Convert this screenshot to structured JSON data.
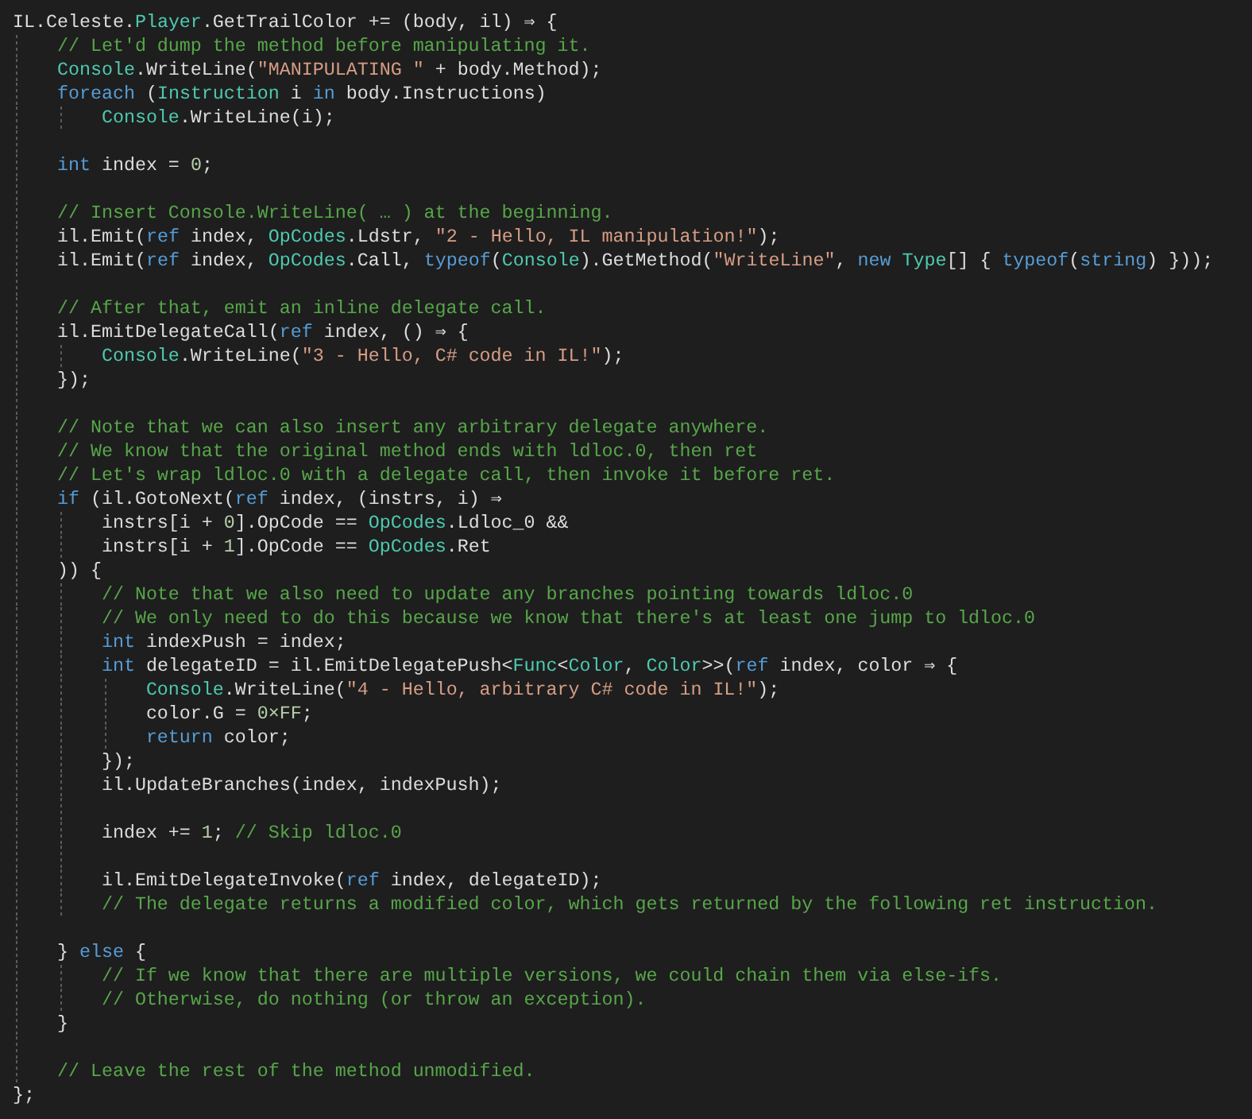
{
  "editor": {
    "lines": [
      {
        "kind": "code",
        "tokens": [
          {
            "kind": "plain",
            "text": "IL.Celeste."
          },
          {
            "kind": "type",
            "text": "Player"
          },
          {
            "kind": "plain",
            "text": ".GetTrailColor += (body, il) ⇒ {"
          }
        ]
      },
      {
        "kind": "code",
        "tokens": [
          {
            "kind": "comment",
            "text": "    // Let'd dump the method before manipulating it."
          }
        ]
      },
      {
        "kind": "code",
        "tokens": [
          {
            "kind": "type",
            "text": "    Console"
          },
          {
            "kind": "plain",
            "text": ".WriteLine("
          },
          {
            "kind": "string",
            "text": "\"MANIPULATING \""
          },
          {
            "kind": "plain",
            "text": " + body.Method);"
          }
        ]
      },
      {
        "kind": "code",
        "tokens": [
          {
            "kind": "keyword",
            "text": "    foreach"
          },
          {
            "kind": "plain",
            "text": " ("
          },
          {
            "kind": "type",
            "text": "Instruction"
          },
          {
            "kind": "plain",
            "text": " i "
          },
          {
            "kind": "keyword",
            "text": "in"
          },
          {
            "kind": "plain",
            "text": " body.Instructions)"
          }
        ]
      },
      {
        "kind": "code",
        "tokens": [
          {
            "kind": "type",
            "text": "        Console"
          },
          {
            "kind": "plain",
            "text": ".WriteLine(i);"
          }
        ]
      },
      {
        "kind": "blank"
      },
      {
        "kind": "code",
        "tokens": [
          {
            "kind": "keyword",
            "text": "    int"
          },
          {
            "kind": "plain",
            "text": " index = "
          },
          {
            "kind": "number",
            "text": "0"
          },
          {
            "kind": "plain",
            "text": ";"
          }
        ]
      },
      {
        "kind": "blank"
      },
      {
        "kind": "code",
        "tokens": [
          {
            "kind": "comment",
            "text": "    // Insert Console.WriteLine( … ) at the beginning."
          }
        ]
      },
      {
        "kind": "code",
        "tokens": [
          {
            "kind": "plain",
            "text": "    il.Emit("
          },
          {
            "kind": "keyword",
            "text": "ref"
          },
          {
            "kind": "plain",
            "text": " index, "
          },
          {
            "kind": "type",
            "text": "OpCodes"
          },
          {
            "kind": "plain",
            "text": ".Ldstr, "
          },
          {
            "kind": "string",
            "text": "\"2 - Hello, IL manipulation!\""
          },
          {
            "kind": "plain",
            "text": ");"
          }
        ]
      },
      {
        "kind": "code",
        "tokens": [
          {
            "kind": "plain",
            "text": "    il.Emit("
          },
          {
            "kind": "keyword",
            "text": "ref"
          },
          {
            "kind": "plain",
            "text": " index, "
          },
          {
            "kind": "type",
            "text": "OpCodes"
          },
          {
            "kind": "plain",
            "text": ".Call, "
          },
          {
            "kind": "keyword",
            "text": "typeof"
          },
          {
            "kind": "plain",
            "text": "("
          },
          {
            "kind": "type",
            "text": "Console"
          },
          {
            "kind": "plain",
            "text": ").GetMethod("
          },
          {
            "kind": "string",
            "text": "\"WriteLine\""
          },
          {
            "kind": "plain",
            "text": ", "
          },
          {
            "kind": "keyword",
            "text": "new"
          },
          {
            "kind": "type",
            "text": " Type"
          },
          {
            "kind": "plain",
            "text": "[] { "
          },
          {
            "kind": "keyword",
            "text": "typeof"
          },
          {
            "kind": "plain",
            "text": "("
          },
          {
            "kind": "keyword",
            "text": "string"
          },
          {
            "kind": "plain",
            "text": ") }));"
          }
        ]
      },
      {
        "kind": "blank"
      },
      {
        "kind": "code",
        "tokens": [
          {
            "kind": "comment",
            "text": "    // After that, emit an inline delegate call."
          }
        ]
      },
      {
        "kind": "code",
        "tokens": [
          {
            "kind": "plain",
            "text": "    il.EmitDelegateCall("
          },
          {
            "kind": "keyword",
            "text": "ref"
          },
          {
            "kind": "plain",
            "text": " index, () ⇒ {"
          }
        ]
      },
      {
        "kind": "code",
        "tokens": [
          {
            "kind": "type",
            "text": "        Console"
          },
          {
            "kind": "plain",
            "text": ".WriteLine("
          },
          {
            "kind": "string",
            "text": "\"3 - Hello, C# code in IL!\""
          },
          {
            "kind": "plain",
            "text": ");"
          }
        ]
      },
      {
        "kind": "code",
        "tokens": [
          {
            "kind": "plain",
            "text": "    });"
          }
        ]
      },
      {
        "kind": "blank"
      },
      {
        "kind": "code",
        "tokens": [
          {
            "kind": "comment",
            "text": "    // Note that we can also insert any arbitrary delegate anywhere."
          }
        ]
      },
      {
        "kind": "code",
        "tokens": [
          {
            "kind": "comment",
            "text": "    // We know that the original method ends with ldloc.0, then ret"
          }
        ]
      },
      {
        "kind": "code",
        "tokens": [
          {
            "kind": "comment",
            "text": "    // Let's wrap ldloc.0 with a delegate call, then invoke it before ret."
          }
        ]
      },
      {
        "kind": "code",
        "tokens": [
          {
            "kind": "keyword",
            "text": "    if"
          },
          {
            "kind": "plain",
            "text": " (il.GotoNext("
          },
          {
            "kind": "keyword",
            "text": "ref"
          },
          {
            "kind": "plain",
            "text": " index, (instrs, i) ⇒"
          }
        ]
      },
      {
        "kind": "code",
        "tokens": [
          {
            "kind": "plain",
            "text": "        instrs[i + "
          },
          {
            "kind": "number",
            "text": "0"
          },
          {
            "kind": "plain",
            "text": "].OpCode == "
          },
          {
            "kind": "type",
            "text": "OpCodes"
          },
          {
            "kind": "plain",
            "text": ".Ldloc_0 &&"
          }
        ]
      },
      {
        "kind": "code",
        "tokens": [
          {
            "kind": "plain",
            "text": "        instrs[i + "
          },
          {
            "kind": "number",
            "text": "1"
          },
          {
            "kind": "plain",
            "text": "].OpCode == "
          },
          {
            "kind": "type",
            "text": "OpCodes"
          },
          {
            "kind": "plain",
            "text": ".Ret"
          }
        ]
      },
      {
        "kind": "code",
        "tokens": [
          {
            "kind": "plain",
            "text": "    )) {"
          }
        ]
      },
      {
        "kind": "code",
        "tokens": [
          {
            "kind": "comment",
            "text": "        // Note that we also need to update any branches pointing towards ldloc.0"
          }
        ]
      },
      {
        "kind": "code",
        "tokens": [
          {
            "kind": "comment",
            "text": "        // We only need to do this because we know that there's at least one jump to ldloc.0"
          }
        ]
      },
      {
        "kind": "code",
        "tokens": [
          {
            "kind": "keyword",
            "text": "        int"
          },
          {
            "kind": "plain",
            "text": " indexPush = index;"
          }
        ]
      },
      {
        "kind": "code",
        "tokens": [
          {
            "kind": "keyword",
            "text": "        int"
          },
          {
            "kind": "plain",
            "text": " delegateID = il.EmitDelegatePush<"
          },
          {
            "kind": "type",
            "text": "Func"
          },
          {
            "kind": "plain",
            "text": "<"
          },
          {
            "kind": "type",
            "text": "Color"
          },
          {
            "kind": "plain",
            "text": ", "
          },
          {
            "kind": "type",
            "text": "Color"
          },
          {
            "kind": "plain",
            "text": ">>("
          },
          {
            "kind": "keyword",
            "text": "ref"
          },
          {
            "kind": "plain",
            "text": " index, color ⇒ {"
          }
        ]
      },
      {
        "kind": "code",
        "tokens": [
          {
            "kind": "type",
            "text": "            Console"
          },
          {
            "kind": "plain",
            "text": ".WriteLine("
          },
          {
            "kind": "string",
            "text": "\"4 - Hello, arbitrary C# code in IL!\""
          },
          {
            "kind": "plain",
            "text": ");"
          }
        ]
      },
      {
        "kind": "code",
        "tokens": [
          {
            "kind": "plain",
            "text": "            color.G = "
          },
          {
            "kind": "number",
            "text": "0×FF"
          },
          {
            "kind": "plain",
            "text": ";"
          }
        ]
      },
      {
        "kind": "code",
        "tokens": [
          {
            "kind": "keyword",
            "text": "            return"
          },
          {
            "kind": "plain",
            "text": " color;"
          }
        ]
      },
      {
        "kind": "code",
        "tokens": [
          {
            "kind": "plain",
            "text": "        });"
          }
        ]
      },
      {
        "kind": "code",
        "tokens": [
          {
            "kind": "plain",
            "text": "        il.UpdateBranches(index, indexPush);"
          }
        ]
      },
      {
        "kind": "blank"
      },
      {
        "kind": "code",
        "tokens": [
          {
            "kind": "plain",
            "text": "        index += "
          },
          {
            "kind": "number",
            "text": "1"
          },
          {
            "kind": "plain",
            "text": ";"
          },
          {
            "kind": "comment",
            "text": " // Skip ldloc.0"
          }
        ]
      },
      {
        "kind": "blank"
      },
      {
        "kind": "code",
        "tokens": [
          {
            "kind": "plain",
            "text": "        il.EmitDelegateInvoke("
          },
          {
            "kind": "keyword",
            "text": "ref"
          },
          {
            "kind": "plain",
            "text": " index, delegateID);"
          }
        ]
      },
      {
        "kind": "code",
        "tokens": [
          {
            "kind": "comment",
            "text": "        // The delegate returns a modified color, which gets returned by the following ret instruction."
          }
        ]
      },
      {
        "kind": "blank"
      },
      {
        "kind": "code",
        "tokens": [
          {
            "kind": "plain",
            "text": "    } "
          },
          {
            "kind": "keyword",
            "text": "else"
          },
          {
            "kind": "plain",
            "text": " {"
          }
        ]
      },
      {
        "kind": "code",
        "tokens": [
          {
            "kind": "comment",
            "text": "        // If we know that there are multiple versions, we could chain them via else-ifs."
          }
        ]
      },
      {
        "kind": "code",
        "tokens": [
          {
            "kind": "comment",
            "text": "        // Otherwise, do nothing (or throw an exception)."
          }
        ]
      },
      {
        "kind": "code",
        "tokens": [
          {
            "kind": "plain",
            "text": "    }"
          }
        ]
      },
      {
        "kind": "blank"
      },
      {
        "kind": "code",
        "tokens": [
          {
            "kind": "comment",
            "text": "    // Leave the rest of the method unmodified."
          }
        ]
      },
      {
        "kind": "code",
        "tokens": [
          {
            "kind": "plain",
            "text": "};"
          }
        ]
      }
    ]
  }
}
